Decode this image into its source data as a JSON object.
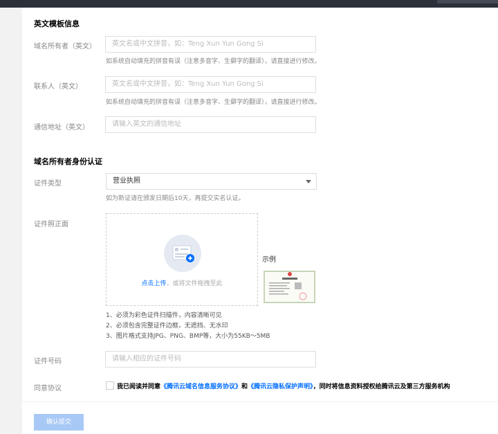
{
  "en_section": {
    "title": "英文模板信息",
    "owner_label": "域名所有者（英文）",
    "owner_placeholder": "英文名或中文拼音，如：Teng Xun Yun Gong Si",
    "owner_hint": "如系统自动填充的拼音有误（注意多音字、生僻字的翻译），请直接进行修改。",
    "contact_label": "联系人（英文）",
    "contact_placeholder": "英文名或中文拼音，如：Teng Xun Yun Gong Si",
    "contact_hint": "如系统自动填充的拼音有误（注意多音字、生僻字的翻译），请直接进行修改。",
    "address_label": "通信地址（英文）",
    "address_placeholder": "请输入英文的通信地址"
  },
  "id_section": {
    "title": "域名所有者身份认证",
    "cert_type_label": "证件类型",
    "cert_type_value": "营业执照",
    "cert_type_hint": "如为新证请在颁发日期后10天，再提交实名认证。",
    "front_label": "证件照正面",
    "upload_link": "点击上传",
    "upload_rest": "，或将文件拖拽至此",
    "example_label": "示例",
    "requirements": [
      "1、必须为彩色证件扫描件，内容清晰可见",
      "2、必须包含完整证件边框，无遮挡、无水印",
      "3、图片格式支持JPG、PNG、BMP等，大小为55KB～5MB"
    ],
    "cert_no_label": "证件号码",
    "cert_no_placeholder": "请输入相应的证件号码",
    "agreement_label": "同意协议",
    "agree_prefix": "我已阅读并同意",
    "agree_link1": "《腾讯云域名信息服务协议》",
    "agree_and": "和",
    "agree_link2": "《腾讯云隐私保护声明》",
    "agree_suffix": "，同时将信息资料授权给腾讯云及第三方服务机构"
  },
  "actions": {
    "submit_label": "确认提交"
  },
  "colors": {
    "accent": "#006eff",
    "submit_disabled": "#a8c9f5",
    "topbar": "#2b3139"
  }
}
